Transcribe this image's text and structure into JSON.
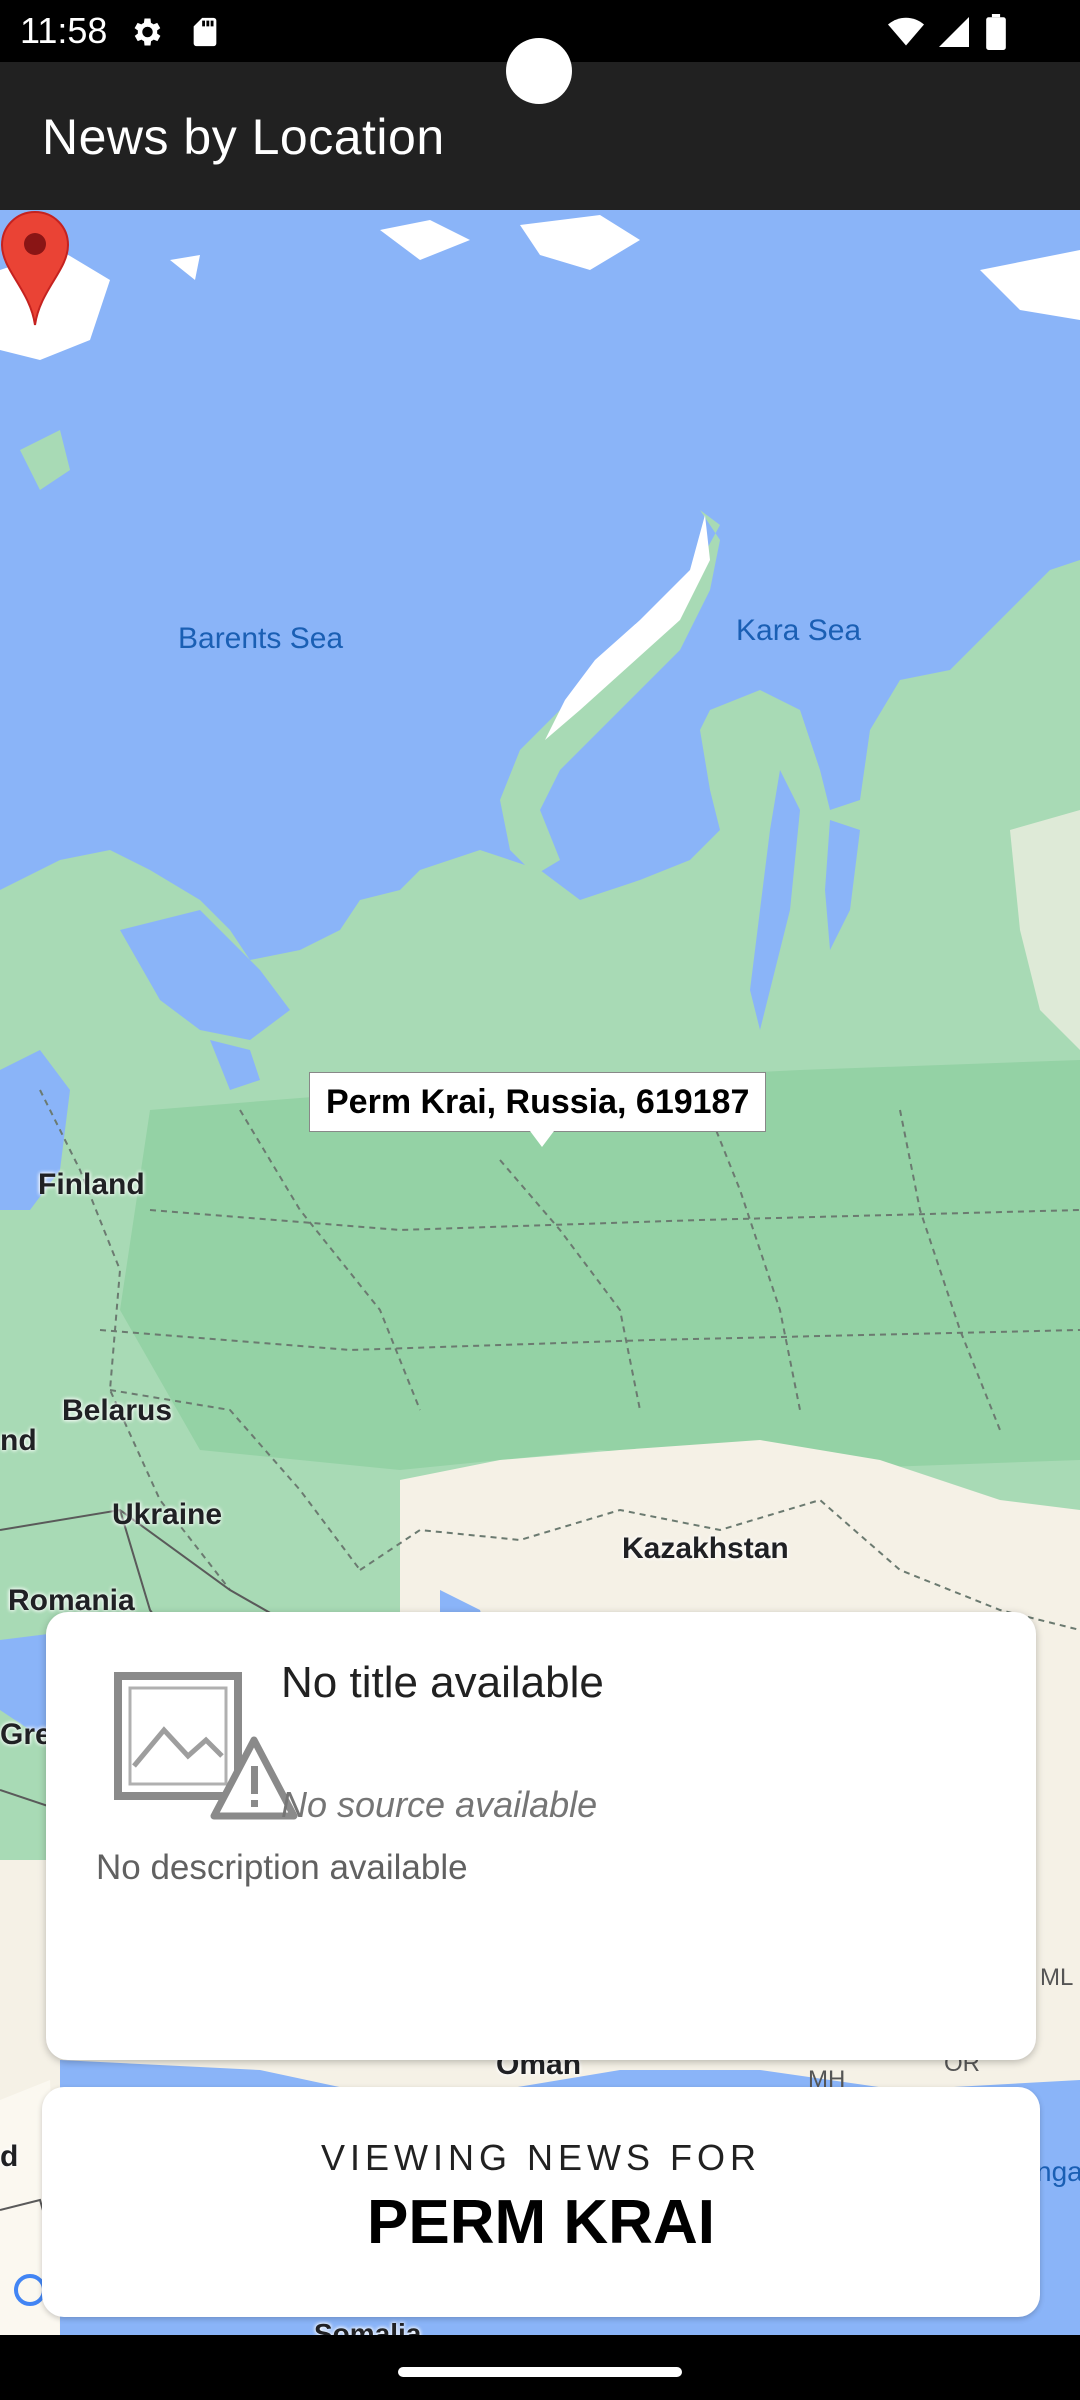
{
  "status_bar": {
    "time": "11:58",
    "icons": [
      "settings-icon",
      "sd-card-icon",
      "wifi-icon",
      "cellular-icon",
      "battery-icon"
    ]
  },
  "app_bar": {
    "title": "News by Location"
  },
  "map": {
    "labels": {
      "barents_sea": "Barents Sea",
      "kara_sea": "Kara Sea",
      "finland": "Finland",
      "belarus": "Belarus",
      "ukraine": "Ukraine",
      "romania": "Romania",
      "kazakhstan": "Kazakhstan",
      "oman": "Oman",
      "somalia": "Somalia",
      "nd_fragment": "nd",
      "d_fragment": "d",
      "gree_fragment": "Gree",
      "mh_fragment": "MH",
      "or_fragment": "OR",
      "ml_fragment": "ML",
      "nga_fragment": "nga"
    },
    "marker_info": "Perm Krai, Russia, 619187",
    "colors": {
      "water": "#8ab4f8",
      "land": "#a8dab5",
      "land_dark": "#94d2a5",
      "desert": "#f5f1e6",
      "marker": "#ea4335"
    }
  },
  "news_card": {
    "thumbnail_icon": "broken-image-icon",
    "title": "No title available",
    "source": "No source available",
    "description": "No description available"
  },
  "viewing_card": {
    "label": "VIEWING NEWS FOR",
    "location": "PERM KRAI"
  }
}
